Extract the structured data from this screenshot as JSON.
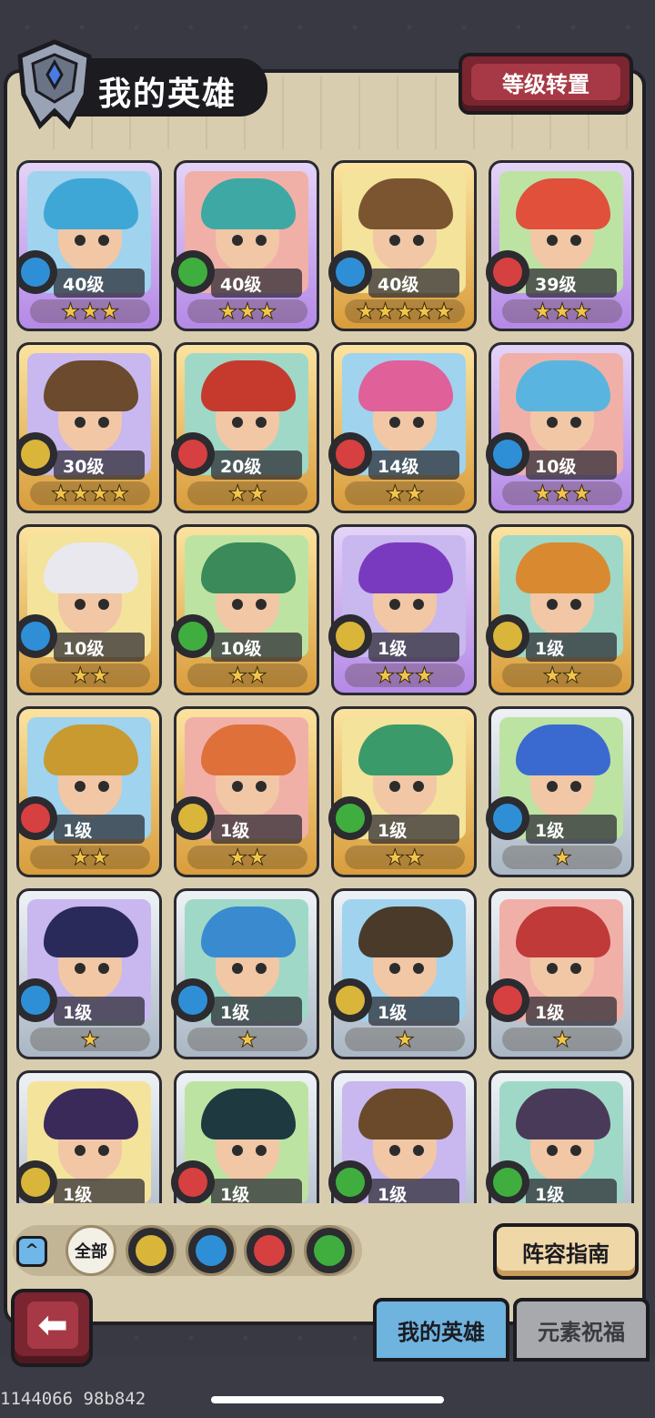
{
  "header": {
    "title": "我的英雄",
    "level_transfer_label": "等级转置"
  },
  "colors": {
    "water": "#2f8fd6",
    "wood": "#3fae3f",
    "fire": "#d64040",
    "earth": "#d9b53a"
  },
  "heroes": [
    {
      "level": "40级",
      "stars": "★★★",
      "element": "water",
      "frame": "purple",
      "hair": "#3fa7d6"
    },
    {
      "level": "40级",
      "stars": "★★★",
      "element": "wood",
      "frame": "purple",
      "hair": "#3ea8a4"
    },
    {
      "level": "40级",
      "stars": "★★★★★",
      "element": "water",
      "frame": "gold",
      "hair": "#7a5530"
    },
    {
      "level": "39级",
      "stars": "★★★",
      "element": "fire",
      "frame": "purple",
      "hair": "#e0503a"
    },
    {
      "level": "30级",
      "stars": "★★★★",
      "element": "earth",
      "frame": "gold",
      "hair": "#6b4a2e"
    },
    {
      "level": "20级",
      "stars": "★★",
      "element": "fire",
      "frame": "gold",
      "hair": "#c63a2e"
    },
    {
      "level": "14级",
      "stars": "★★",
      "element": "fire",
      "frame": "gold",
      "hair": "#e0609a"
    },
    {
      "level": "10级",
      "stars": "★★★",
      "element": "water",
      "frame": "purple",
      "hair": "#5ab4e0"
    },
    {
      "level": "10级",
      "stars": "★★",
      "element": "water",
      "frame": "gold",
      "hair": "#e8e8ee"
    },
    {
      "level": "10级",
      "stars": "★★",
      "element": "wood",
      "frame": "gold",
      "hair": "#3a8a5a"
    },
    {
      "level": "1级",
      "stars": "★★★",
      "element": "earth",
      "frame": "purple",
      "hair": "#7a3ac0"
    },
    {
      "level": "1级",
      "stars": "★★",
      "element": "earth",
      "frame": "gold",
      "hair": "#d98a30"
    },
    {
      "level": "1级",
      "stars": "★★",
      "element": "fire",
      "frame": "gold",
      "hair": "#c89a30"
    },
    {
      "level": "1级",
      "stars": "★★",
      "element": "earth",
      "frame": "gold",
      "hair": "#e0703a"
    },
    {
      "level": "1级",
      "stars": "★★",
      "element": "wood",
      "frame": "gold",
      "hair": "#3a9a6a"
    },
    {
      "level": "1级",
      "stars": "★",
      "element": "water",
      "frame": "silver",
      "hair": "#3a6ad0"
    },
    {
      "level": "1级",
      "stars": "★",
      "element": "water",
      "frame": "silver",
      "hair": "#2a2a5a"
    },
    {
      "level": "1级",
      "stars": "★",
      "element": "water",
      "frame": "silver",
      "hair": "#3a8ad0"
    },
    {
      "level": "1级",
      "stars": "★",
      "element": "earth",
      "frame": "silver",
      "hair": "#4a3a2a"
    },
    {
      "level": "1级",
      "stars": "★",
      "element": "fire",
      "frame": "silver",
      "hair": "#c03a3a"
    },
    {
      "level": "1级",
      "stars": "",
      "element": "earth",
      "frame": "silver",
      "hair": "#3a2a5a"
    },
    {
      "level": "1级",
      "stars": "",
      "element": "fire",
      "frame": "silver",
      "hair": "#1e3a40"
    },
    {
      "level": "1级",
      "stars": "",
      "element": "wood",
      "frame": "silver",
      "hair": "#6a4a2a"
    },
    {
      "level": "1级",
      "stars": "",
      "element": "wood",
      "frame": "silver",
      "hair": "#4a3a5a"
    }
  ],
  "filters": {
    "all_label": "全部",
    "elements": [
      "earth",
      "water",
      "fire",
      "wood"
    ]
  },
  "guide_label": "阵容指南",
  "tabs": {
    "my_heroes": "我的英雄",
    "element_blessing": "元素祝福"
  },
  "footer_id": "1144066 98b842"
}
